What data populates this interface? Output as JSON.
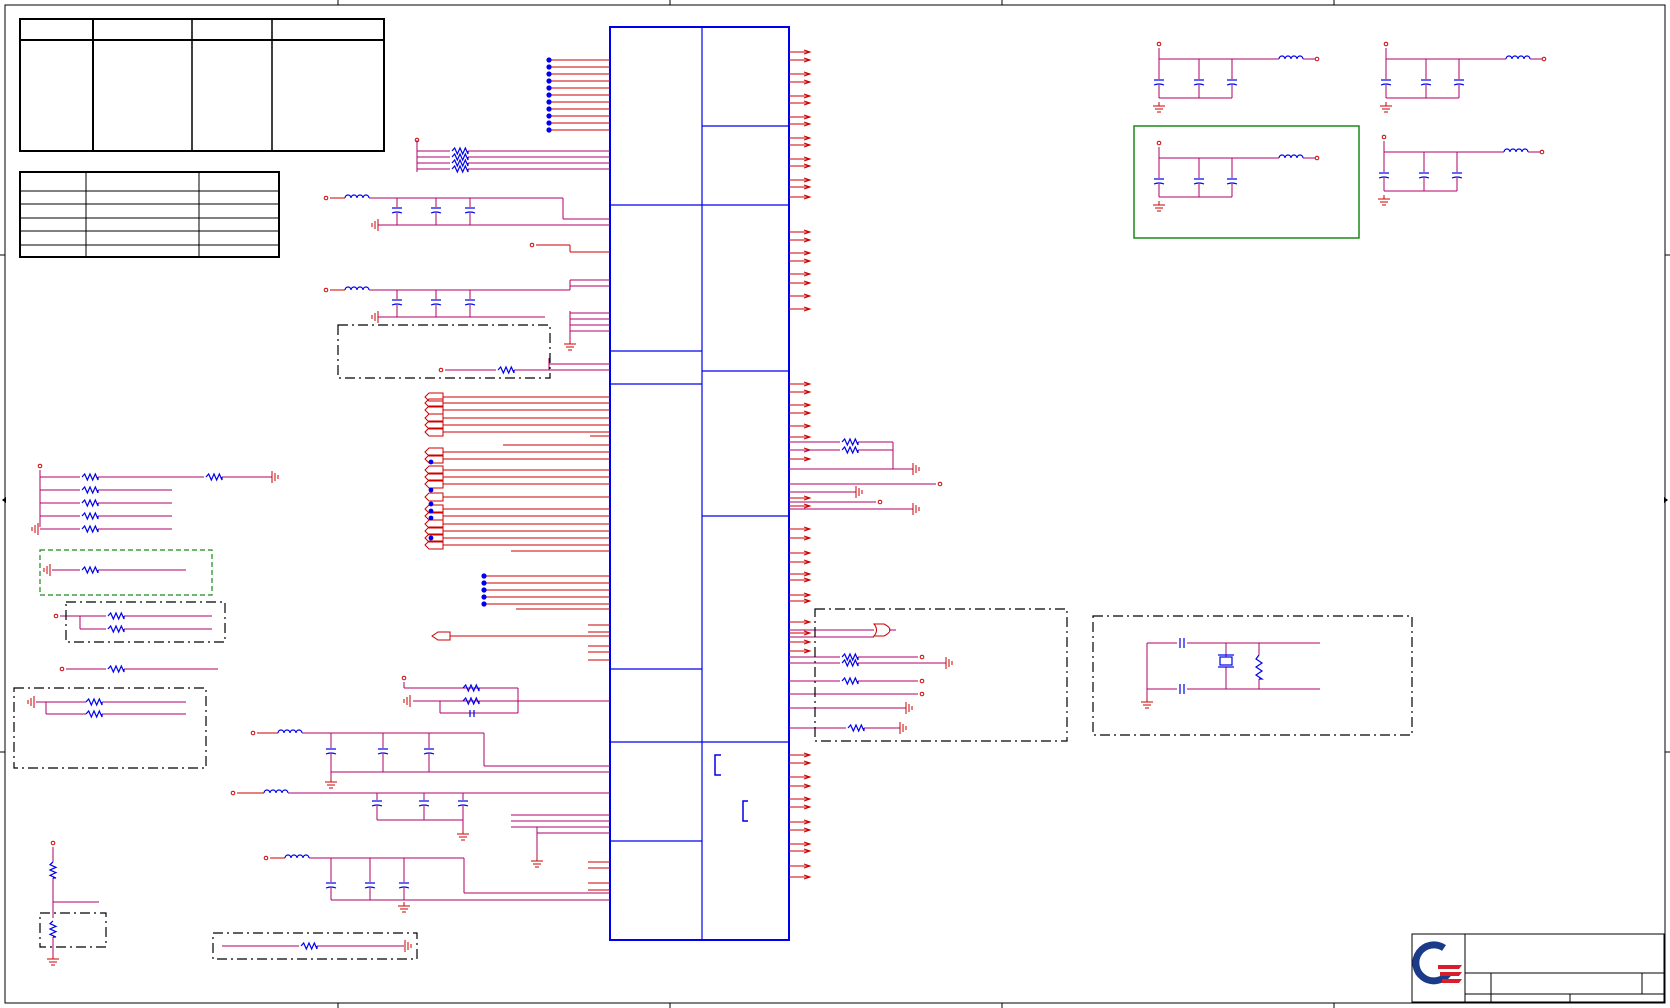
{
  "sheet": {
    "border_color": "#000000",
    "wire_color": "#cc0000",
    "net_color": "#b00068",
    "part_color": "#0000ee",
    "frame_color": "#3030cc",
    "highlight_color": "#1a8a1a"
  },
  "title_block": {
    "logo_icon": "company-logo-icon",
    "logo_colors": [
      "#1a3a8a",
      "#d81e2a"
    ]
  },
  "tables": {
    "revision_table_columns": 4,
    "pin_table_rows": 5
  }
}
